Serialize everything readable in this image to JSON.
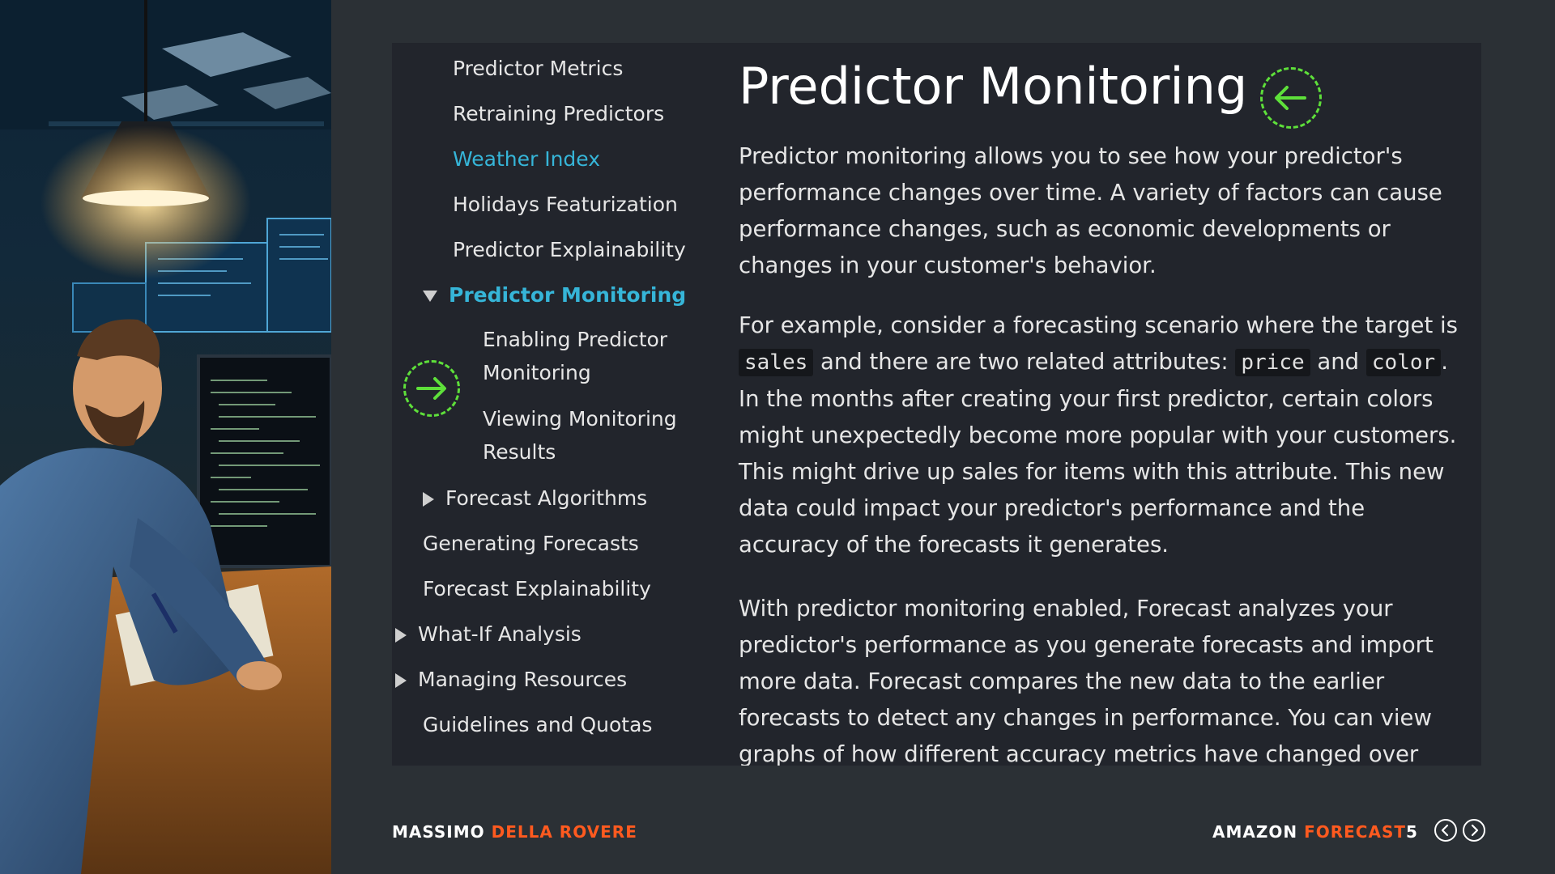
{
  "toc": {
    "items": [
      {
        "label": "Predictor Metrics"
      },
      {
        "label": "Retraining Predictors"
      },
      {
        "label": "Weather Index"
      },
      {
        "label": "Holidays Featurization"
      },
      {
        "label": "Predictor Explainability"
      },
      {
        "label": "Predictor Monitoring"
      },
      {
        "label": "Enabling Predictor Monitoring"
      },
      {
        "label": "Viewing Monitoring Results"
      },
      {
        "label": "Forecast Algorithms"
      },
      {
        "label": "Generating Forecasts"
      },
      {
        "label": "Forecast Explainability"
      },
      {
        "label": "What-If Analysis"
      },
      {
        "label": "Managing Resources"
      },
      {
        "label": "Guidelines and Quotas"
      }
    ]
  },
  "content": {
    "title": "Predictor Monitoring",
    "p1": "Predictor monitoring allows you to see how your predictor's performance changes over time. A variety of factors can cause performance changes, such as economic developments or changes in your customer's behavior.",
    "p2": {
      "a": "For example, consider a forecasting scenario where the target is",
      "code1": "sales",
      "b": "and there are two related attributes:",
      "code2": "price",
      "c": "and",
      "code3": "color",
      "d": ". In the months after creating your first predictor, certain colors might unexpectedly become more popular with your customers. This might drive up sales for items with this attribute. This new data could impact your predictor's performance and the accuracy of the forecasts it generates."
    },
    "p3": "With predictor monitoring enabled, Forecast analyzes your predictor's performance as you generate forecasts and import more data. Forecast compares the new data to the earlier forecasts to detect any changes in performance. You can view graphs of how different accuracy metrics have changed over time"
  },
  "footer": {
    "author_first": "MASSIMO",
    "author_last": "DELLA ROVERE",
    "product_first": "AMAZON",
    "product_last": "FORECAST",
    "page": "5"
  },
  "colors": {
    "background": "#2b3035",
    "card": "#22252c",
    "accent_blue": "#36b5d8",
    "accent_orange": "#ff5a1f",
    "accent_green": "#5ee03a"
  },
  "icons": {
    "back": "arrow-left-icon",
    "forward": "arrow-right-icon",
    "prev": "chevron-left-icon",
    "next": "chevron-right-icon"
  }
}
